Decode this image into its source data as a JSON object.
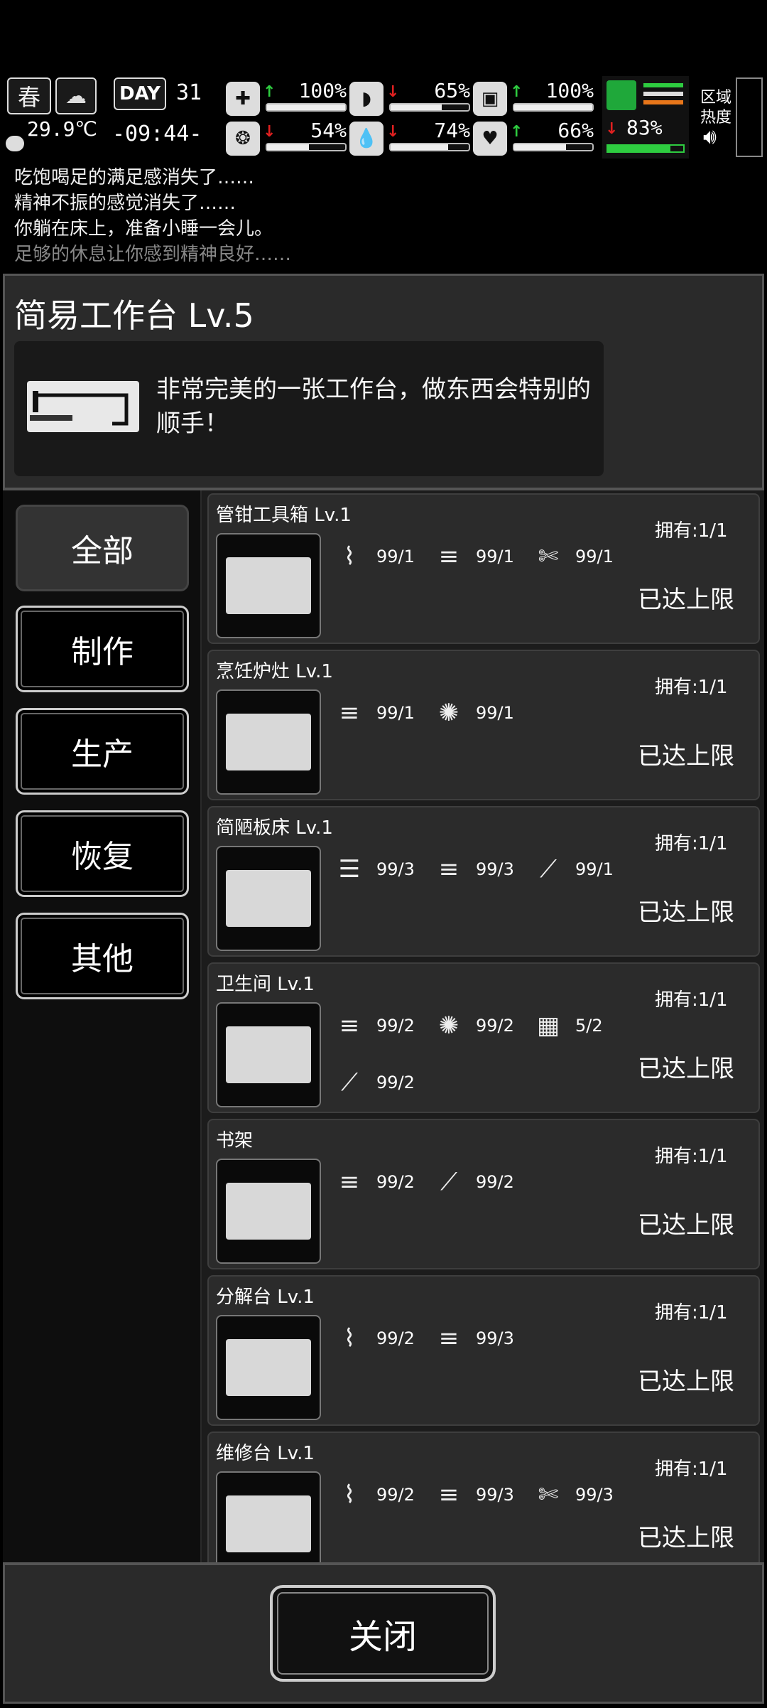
{
  "hud": {
    "season": "春",
    "temperature": "29.9℃",
    "day_label": "DAY",
    "day_number": "31",
    "time": "-09:44-",
    "stats": [
      {
        "name": "health",
        "icon": "medkit-icon",
        "glyph": "✚",
        "trend": "up",
        "value": "100%",
        "level": 1.0
      },
      {
        "name": "hunger",
        "icon": "stomach-icon",
        "glyph": "◗",
        "trend": "down",
        "value": "65%",
        "level": 0.65
      },
      {
        "name": "stamina",
        "icon": "capsule-icon",
        "glyph": "▣",
        "trend": "up",
        "value": "100%",
        "level": 1.0
      },
      {
        "name": "sanity",
        "icon": "brain-icon",
        "glyph": "❂",
        "trend": "down",
        "value": "54%",
        "level": 0.54
      },
      {
        "name": "thirst",
        "icon": "water-drop-icon",
        "glyph": "💧",
        "trend": "down",
        "value": "74%",
        "level": 0.74
      },
      {
        "name": "mood",
        "icon": "heart-icon",
        "glyph": "♥",
        "trend": "up",
        "value": "66%",
        "level": 0.66
      }
    ],
    "leg_trend": "down",
    "leg_value": "83%",
    "leg_level": 0.83,
    "zone_heat_label_1": "区域",
    "zone_heat_label_2": "热度"
  },
  "log": [
    "吃饱喝足的满足感消失了……",
    "精神不振的感觉消失了……",
    "你躺在床上，准备小睡一会儿。",
    "足够的休息让你感到精神良好……"
  ],
  "workbench": {
    "title": "简易工作台 Lv.5",
    "description": "非常完美的一张工作台，做东西会特别的顺手！"
  },
  "tabs": [
    "全部",
    "制作",
    "生产",
    "恢复",
    "其他"
  ],
  "items": [
    {
      "name": "管钳工具箱 Lv.1",
      "owned": "拥有:1/1",
      "status": "已达上限",
      "materials": [
        {
          "icon": "pipe-icon",
          "glyph": "⌇",
          "value": "99/1"
        },
        {
          "icon": "wood-logs-icon",
          "glyph": "≡",
          "value": "99/1"
        },
        {
          "icon": "tape-icon",
          "glyph": "✄",
          "value": "99/1"
        }
      ]
    },
    {
      "name": "烹饪炉灶 Lv.1",
      "owned": "拥有:1/1",
      "status": "已达上限",
      "materials": [
        {
          "icon": "wood-logs-icon",
          "glyph": "≡",
          "value": "99/1"
        },
        {
          "icon": "fiber-icon",
          "glyph": "✺",
          "value": "99/1"
        }
      ]
    },
    {
      "name": "简陋板床 Lv.1",
      "owned": "拥有:1/1",
      "status": "已达上限",
      "materials": [
        {
          "icon": "cloth-icon",
          "glyph": "☰",
          "value": "99/3"
        },
        {
          "icon": "wood-logs-icon",
          "glyph": "≡",
          "value": "99/3"
        },
        {
          "icon": "nails-icon",
          "glyph": "⟋",
          "value": "99/1"
        }
      ]
    },
    {
      "name": "卫生间 Lv.1",
      "owned": "拥有:1/1",
      "status": "已达上限",
      "materials": [
        {
          "icon": "wood-logs-icon",
          "glyph": "≡",
          "value": "99/2"
        },
        {
          "icon": "fiber-icon",
          "glyph": "✺",
          "value": "99/2"
        },
        {
          "icon": "bricks-icon",
          "glyph": "▦",
          "value": "5/2"
        },
        {
          "icon": "nails-icon",
          "glyph": "⟋",
          "value": "99/2"
        }
      ]
    },
    {
      "name": "书架",
      "owned": "拥有:1/1",
      "status": "已达上限",
      "materials": [
        {
          "icon": "wood-logs-icon",
          "glyph": "≡",
          "value": "99/2"
        },
        {
          "icon": "nails-icon",
          "glyph": "⟋",
          "value": "99/2"
        }
      ]
    },
    {
      "name": "分解台 Lv.1",
      "owned": "拥有:1/1",
      "status": "已达上限",
      "materials": [
        {
          "icon": "pipe-icon",
          "glyph": "⌇",
          "value": "99/2"
        },
        {
          "icon": "wood-logs-icon",
          "glyph": "≡",
          "value": "99/3"
        }
      ]
    },
    {
      "name": "维修台 Lv.1",
      "owned": "拥有:1/1",
      "status": "已达上限",
      "materials": [
        {
          "icon": "pipe-icon",
          "glyph": "⌇",
          "value": "99/2"
        },
        {
          "icon": "wood-logs-icon",
          "glyph": "≡",
          "value": "99/3"
        },
        {
          "icon": "tape-icon",
          "glyph": "✄",
          "value": "99/3"
        }
      ]
    }
  ],
  "close_label": "关闭"
}
